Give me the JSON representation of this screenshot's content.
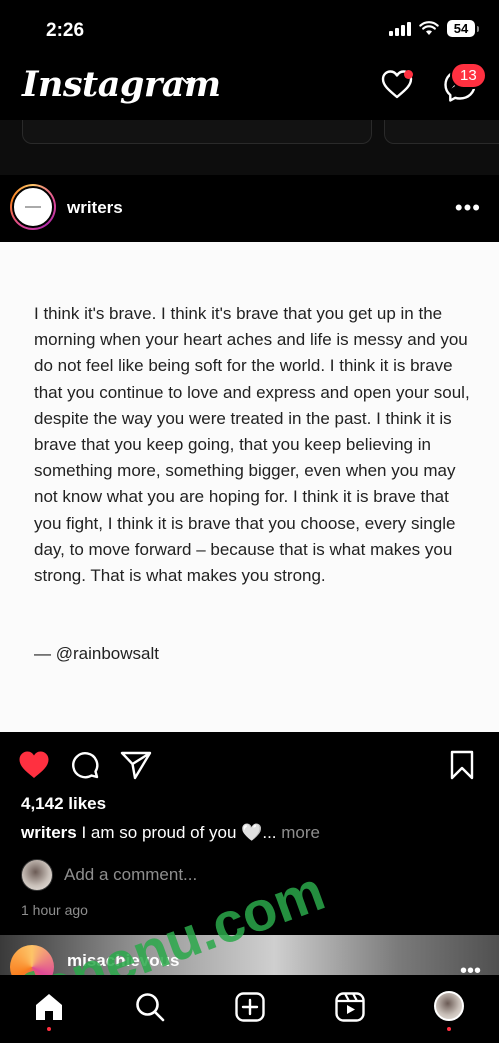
{
  "status_bar": {
    "time": "2:26",
    "battery": "54"
  },
  "header": {
    "logo": "Instagram",
    "messages_badge": "13"
  },
  "post": {
    "username": "writers",
    "quote": "I think it's brave. I think it's brave that you get up in the morning when your heart aches and life is messy and you do not feel like being soft for the world. I think it is brave that you continue to love and express and open your soul, despite the way you were treated in the past. I think it is brave that you keep going, that you keep believing in something more, something bigger, even when you may not know what you are hoping for. I think it is brave that you fight, I think it is brave that you choose, every single day, to move forward – because that is what makes you strong. That is what makes you strong.",
    "quote_author": "— @rainbowsalt",
    "likes": "4,142 likes",
    "caption_user": "writers",
    "caption_text": "I am so proud of you 🤍...",
    "caption_more": "more",
    "comment_placeholder": "Add a comment...",
    "time_ago": "1 hour ago"
  },
  "next_post": {
    "username": "misachievous"
  },
  "watermark": "fonenu.com",
  "colors": {
    "like_red": "#ff3040",
    "story_bar_blue": "#1f7bd8",
    "muted": "#8e8e8e"
  }
}
